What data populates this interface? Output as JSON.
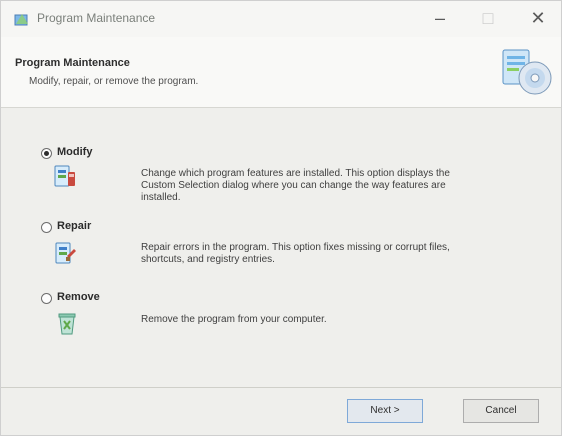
{
  "window": {
    "title": "Program Maintenance",
    "minimize_glyph": "–",
    "maximize_glyph": "□",
    "close_glyph": "✕",
    "icon": "installer-icon"
  },
  "header": {
    "title": "Program Maintenance",
    "subtitle": "Modify, repair, or remove the program.",
    "art": "installer-disc-icon"
  },
  "options": [
    {
      "label": "Modify",
      "selected": true,
      "icon": "modify-icon",
      "description_lines": [
        "Change which program features are installed. This option displays the",
        "Custom Selection dialog where you can change the way features are",
        "installed."
      ]
    },
    {
      "label": "Repair",
      "selected": false,
      "icon": "repair-icon",
      "description_lines": [
        "Repair errors in the program. This option fixes missing or corrupt files,",
        "shortcuts, and registry entries."
      ]
    },
    {
      "label": "Remove",
      "selected": false,
      "icon": "remove-icon",
      "description_lines": [
        "Remove the program from your computer."
      ]
    }
  ],
  "buttons": {
    "next": "Next >",
    "cancel": "Cancel"
  },
  "colors": {
    "accent": "#7fa9d8",
    "icon_green": "#5fa84a",
    "icon_blue": "#3f7fc9",
    "icon_red": "#c94a3f"
  }
}
